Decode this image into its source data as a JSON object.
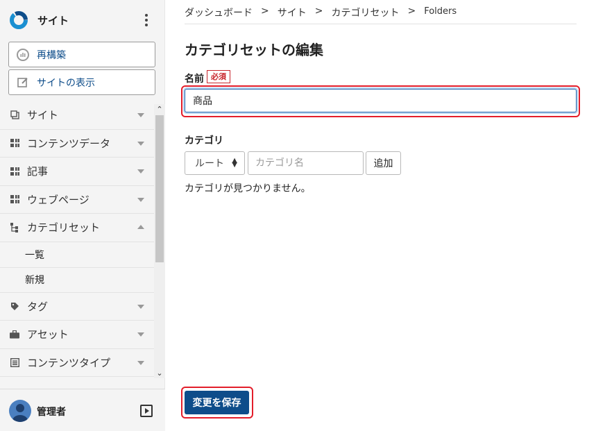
{
  "brand": {
    "name": "サイト"
  },
  "sidebar": {
    "rebuild_label": "再構築",
    "view_site_label": "サイトの表示",
    "items": [
      {
        "label": "サイト",
        "icon": "copy-icon"
      },
      {
        "label": "コンテンツデータ",
        "icon": "grid-icon"
      },
      {
        "label": "記事",
        "icon": "grid-icon"
      },
      {
        "label": "ウェブページ",
        "icon": "grid-icon"
      },
      {
        "label": "カテゴリセット",
        "icon": "hierarchy-icon",
        "expanded": true,
        "subitems": [
          "一覧",
          "新規"
        ]
      },
      {
        "label": "タグ",
        "icon": "tag-icon"
      },
      {
        "label": "アセット",
        "icon": "briefcase-icon"
      },
      {
        "label": "コンテンツタイプ",
        "icon": "content-type-icon"
      }
    ]
  },
  "user": {
    "name": "管理者"
  },
  "breadcrumb": [
    "ダッシュボード",
    "サイト",
    "カテゴリセット",
    "Folders"
  ],
  "page": {
    "title": "カテゴリセットの編集"
  },
  "form": {
    "name_label": "名前",
    "required_label": "必須",
    "name_value": "商品",
    "category_label": "カテゴリ",
    "parent_select_value": "ルート",
    "category_name_placeholder": "カテゴリ名",
    "add_label": "追加",
    "empty_message": "カテゴリが見つかりません。",
    "save_label": "変更を保存"
  },
  "colors": {
    "accent": "#0e4d8a",
    "required": "#c8252c",
    "highlight": "#e31d2a"
  }
}
